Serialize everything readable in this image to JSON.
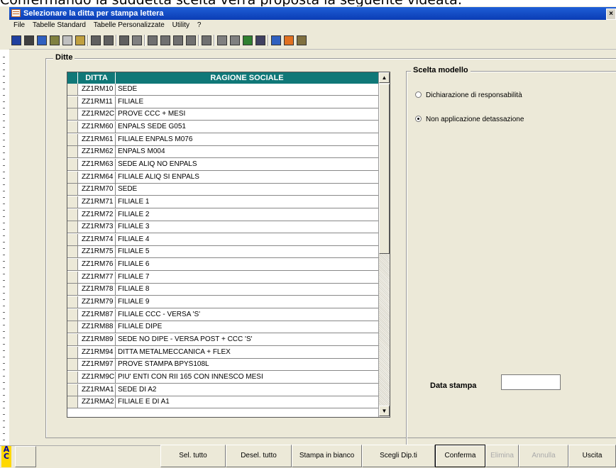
{
  "caption": "Confermando la suddetta scelta verrà proposta la seguente videata:",
  "window": {
    "title": "Selezionare la ditta per stampa lettera",
    "close_label": "×"
  },
  "menu": [
    "File",
    "Tabelle Standard",
    "Tabelle Personalizzate",
    "Utility",
    "?"
  ],
  "toolbar_icons": [
    {
      "name": "save-icon",
      "color": "#2040a0"
    },
    {
      "name": "cancel-icon",
      "color": "#404040"
    },
    {
      "name": "refresh-icon",
      "color": "#3060c0"
    },
    {
      "name": "db-icon",
      "color": "#808040"
    },
    {
      "name": "new-icon",
      "color": "#c0c0c0"
    },
    {
      "name": "open-icon",
      "color": "#c0a040"
    },
    {
      "name": "print-icon",
      "color": "#606060"
    },
    {
      "name": "print-preview-icon",
      "color": "#606060"
    },
    {
      "name": "find-icon",
      "color": "#606060"
    },
    {
      "name": "find-next-icon",
      "color": "#808080"
    },
    {
      "name": "first-record-icon",
      "color": "#707070"
    },
    {
      "name": "prev-record-icon",
      "color": "#707070"
    },
    {
      "name": "next-record-icon",
      "color": "#707070"
    },
    {
      "name": "last-record-icon",
      "color": "#707070"
    },
    {
      "name": "tools-icon",
      "color": "#707070"
    },
    {
      "name": "chart-icon",
      "color": "#808080"
    },
    {
      "name": "calc-icon",
      "color": "#808080"
    },
    {
      "name": "book-icon",
      "color": "#308030"
    },
    {
      "name": "monitor-icon",
      "color": "#404060"
    },
    {
      "name": "users-icon",
      "color": "#3060c0"
    },
    {
      "name": "home-icon",
      "color": "#e07020"
    },
    {
      "name": "list-icon",
      "color": "#807040"
    }
  ],
  "ditte": {
    "label": "Ditte",
    "columns": {
      "code": "DITTA",
      "name": "RAGIONE SOCIALE"
    },
    "rows": [
      {
        "code": "ZZ1RM10",
        "name": "SEDE"
      },
      {
        "code": "ZZ1RM11",
        "name": "FILIALE"
      },
      {
        "code": "ZZ1RM2C",
        "name": "PROVE CCC + MESI"
      },
      {
        "code": "ZZ1RM60",
        "name": "ENPALS SEDE G051"
      },
      {
        "code": "ZZ1RM61",
        "name": "FILIALE ENPALS M076"
      },
      {
        "code": "ZZ1RM62",
        "name": "ENPALS M004"
      },
      {
        "code": "ZZ1RM63",
        "name": "SEDE ALIQ NO ENPALS"
      },
      {
        "code": "ZZ1RM64",
        "name": "FILIALE ALIQ SI ENPALS"
      },
      {
        "code": "ZZ1RM70",
        "name": "SEDE"
      },
      {
        "code": "ZZ1RM71",
        "name": "FILIALE 1"
      },
      {
        "code": "ZZ1RM72",
        "name": "FILIALE 2"
      },
      {
        "code": "ZZ1RM73",
        "name": "FILIALE 3"
      },
      {
        "code": "ZZ1RM74",
        "name": "FILIALE 4"
      },
      {
        "code": "ZZ1RM75",
        "name": "FILIALE 5"
      },
      {
        "code": "ZZ1RM76",
        "name": "FILIALE 6"
      },
      {
        "code": "ZZ1RM77",
        "name": "FILIALE 7"
      },
      {
        "code": "ZZ1RM78",
        "name": "FILIALE 8"
      },
      {
        "code": "ZZ1RM79",
        "name": "FILIALE 9"
      },
      {
        "code": "ZZ1RM87",
        "name": "FILIALE CCC - VERSA 'S'"
      },
      {
        "code": "ZZ1RM88",
        "name": "FILIALE DIPE"
      },
      {
        "code": "ZZ1RM89",
        "name": "SEDE NO DIPE - VERSA POST + CCC 'S'"
      },
      {
        "code": "ZZ1RM94",
        "name": "DITTA METALMECCANICA + FLEX"
      },
      {
        "code": "ZZ1RM97",
        "name": "PROVE STAMPA BPYS108L"
      },
      {
        "code": "ZZ1RM9C",
        "name": "PIU' ENTI CON RII 165 CON INNESCO MESI"
      },
      {
        "code": "ZZ1RMA1",
        "name": "SEDE DI A2"
      },
      {
        "code": "ZZ1RMA2",
        "name": "FILIALE E DI A1"
      }
    ]
  },
  "modello": {
    "label": "Scelta modello",
    "options": [
      {
        "label": "Dichiarazione di responsabilità",
        "checked": false
      },
      {
        "label": "Non applicazione detassazione",
        "checked": true
      }
    ]
  },
  "data_stampa": {
    "label": "Data stampa",
    "value": ""
  },
  "logo_text": "A C",
  "buttons": [
    {
      "label": "Sel. tutto",
      "enabled": true
    },
    {
      "label": "Desel. tutto",
      "enabled": true
    },
    {
      "label": "Stampa in bianco",
      "enabled": true
    },
    {
      "label": "Scegli Dip.ti",
      "enabled": true
    },
    {
      "label": "Conferma",
      "enabled": true
    },
    {
      "label": "Elimina",
      "enabled": false
    },
    {
      "label": "Annulla",
      "enabled": false
    },
    {
      "label": "Uscita",
      "enabled": true
    }
  ]
}
